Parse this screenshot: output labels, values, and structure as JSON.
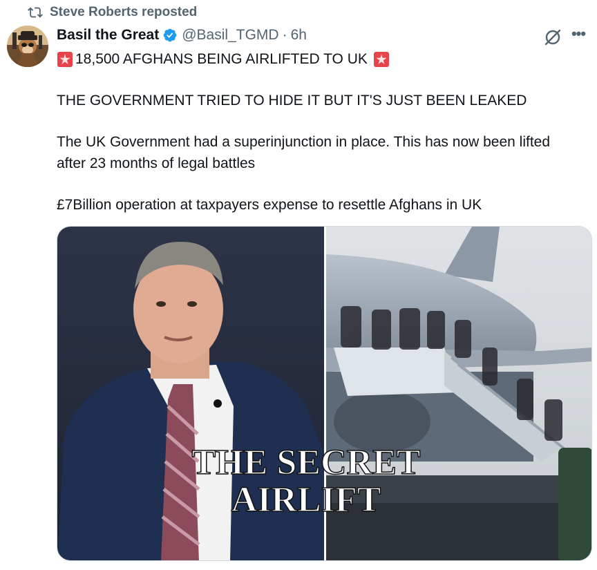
{
  "repost": {
    "label": "Steve Roberts reposted",
    "icon": "repost-icon"
  },
  "author": {
    "display_name": "Basil the Great",
    "verified": true,
    "handle": "@Basil_TGMD",
    "separator": "·",
    "time": "6h"
  },
  "actions": {
    "grok_icon": "grok-icon",
    "more_icon": "more-icon"
  },
  "tweet": {
    "headline": "18,500 AFGHANS BEING AIRLIFTED TO UK",
    "headline_emoji": "police-light-emoji",
    "line2": "THE GOVERNMENT TRIED TO HIDE IT BUT IT'S JUST BEEN LEAKED",
    "line3": "The UK Government had a superinjunction in place. This has now been lifted after 23 months of legal battles",
    "line4": "£7Billion operation at taxpayers expense to resettle Afghans in UK"
  },
  "media": {
    "overlay_line1": "THE SECRET",
    "overlay_line2": "AIRLIFT"
  },
  "colors": {
    "text_primary": "#0f1419",
    "text_secondary": "#536471",
    "verified_blue": "#1d9bf0",
    "border": "#cfd9de"
  }
}
